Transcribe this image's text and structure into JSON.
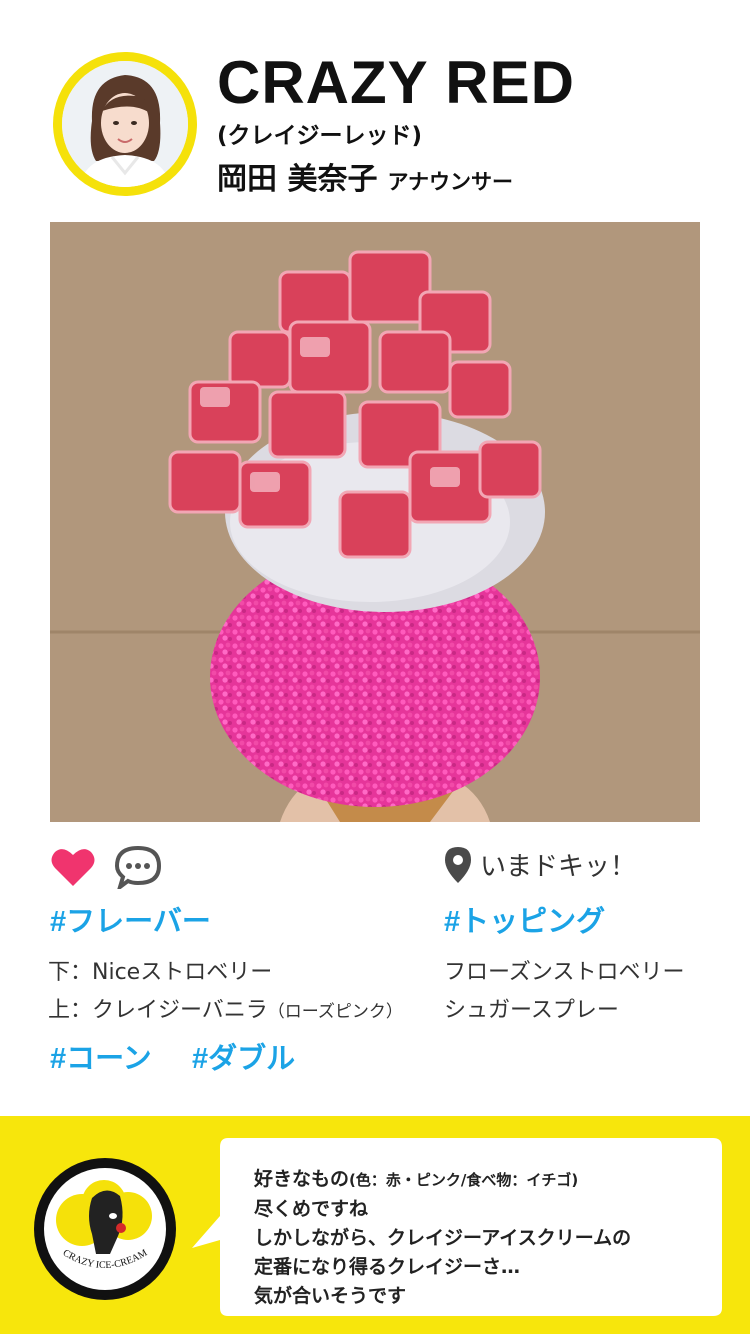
{
  "header": {
    "title": "CRAZY RED",
    "subtitle": "(クレイジーレッド)",
    "announcer_name": "岡田 美奈子",
    "announcer_role": "アナウンサー"
  },
  "photo": {
    "description_icon": "ice-cream-photo"
  },
  "actions": {
    "like_icon": "heart-icon",
    "comment_icon": "comment-icon",
    "location_icon": "map-pin-icon",
    "location_text": "いまドキッ！"
  },
  "flavor": {
    "tag": "#フレーバー",
    "bottom": "下：Niceストロベリー",
    "top": "上：クレイジーバニラ",
    "top_note": "（ローズピンク）"
  },
  "topping": {
    "tag": "#トッピング",
    "item1": "フローズンストロベリー",
    "item2": "シュガースプレー"
  },
  "extra_tags": {
    "cone": "#コーン",
    "double": "#ダブル"
  },
  "footer": {
    "brand": "CRAZY ICE-CREAM",
    "comment": {
      "line1_main": "好きなもの",
      "line1_paren": "(色：赤・ピンク/食べ物：イチゴ)",
      "line2": "尽くめですね",
      "line3": "しかしながら、クレイジーアイスクリームの",
      "line4": "定番になり得るクレイジーさ…",
      "line5": "気が合いそうです"
    }
  },
  "colors": {
    "accent_yellow": "#f7e60c",
    "tag_blue": "#1ba3e6",
    "heart_pink": "#f0346e"
  }
}
